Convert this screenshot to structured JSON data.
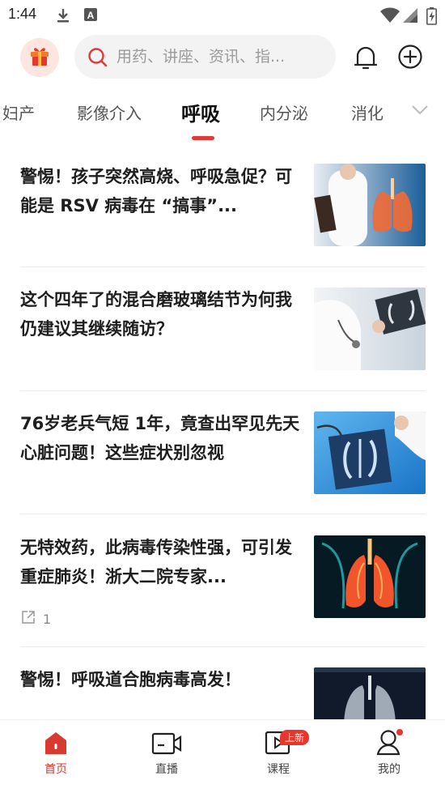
{
  "status_bar": {
    "time": "1:44"
  },
  "search": {
    "placeholder": "用药、讲座、资讯、指..."
  },
  "tabs": [
    {
      "label": "妇产"
    },
    {
      "label": "影像介入"
    },
    {
      "label": "呼吸"
    },
    {
      "label": "内分泌"
    },
    {
      "label": "消化"
    }
  ],
  "articles": [
    {
      "title": "警惕！孩子突然高烧、呼吸急促？可能是 RSV 病毒在 “搞事”...",
      "thumb": "doctor-lungs-image"
    },
    {
      "title": "这个四年了的混合磨玻璃结节为何我仍建议其继续随访？",
      "thumb": "doctor-xray-image"
    },
    {
      "title": "76岁老兵气短 1年，竟查出罕见先天心脏问题！这些症状别忽视",
      "thumb": "chest-xray-image"
    },
    {
      "title": "无特效药，此病毒传染性强，可引发重症肺炎！浙大二院专家...",
      "thumb": "lungs-3d-image",
      "share_count": "1"
    },
    {
      "title": "警惕！呼吸道合胞病毒高发！",
      "thumb": "lung-ct-image"
    }
  ],
  "bottom_nav": [
    {
      "label": "首页",
      "icon": "home-icon"
    },
    {
      "label": "直播",
      "icon": "live-camera-icon"
    },
    {
      "label": "课程",
      "icon": "course-play-icon",
      "badge": "上新"
    },
    {
      "label": "我的",
      "icon": "profile-icon"
    }
  ],
  "colors": {
    "accent": "#e03a3a",
    "active_nav": "#d83a30"
  }
}
